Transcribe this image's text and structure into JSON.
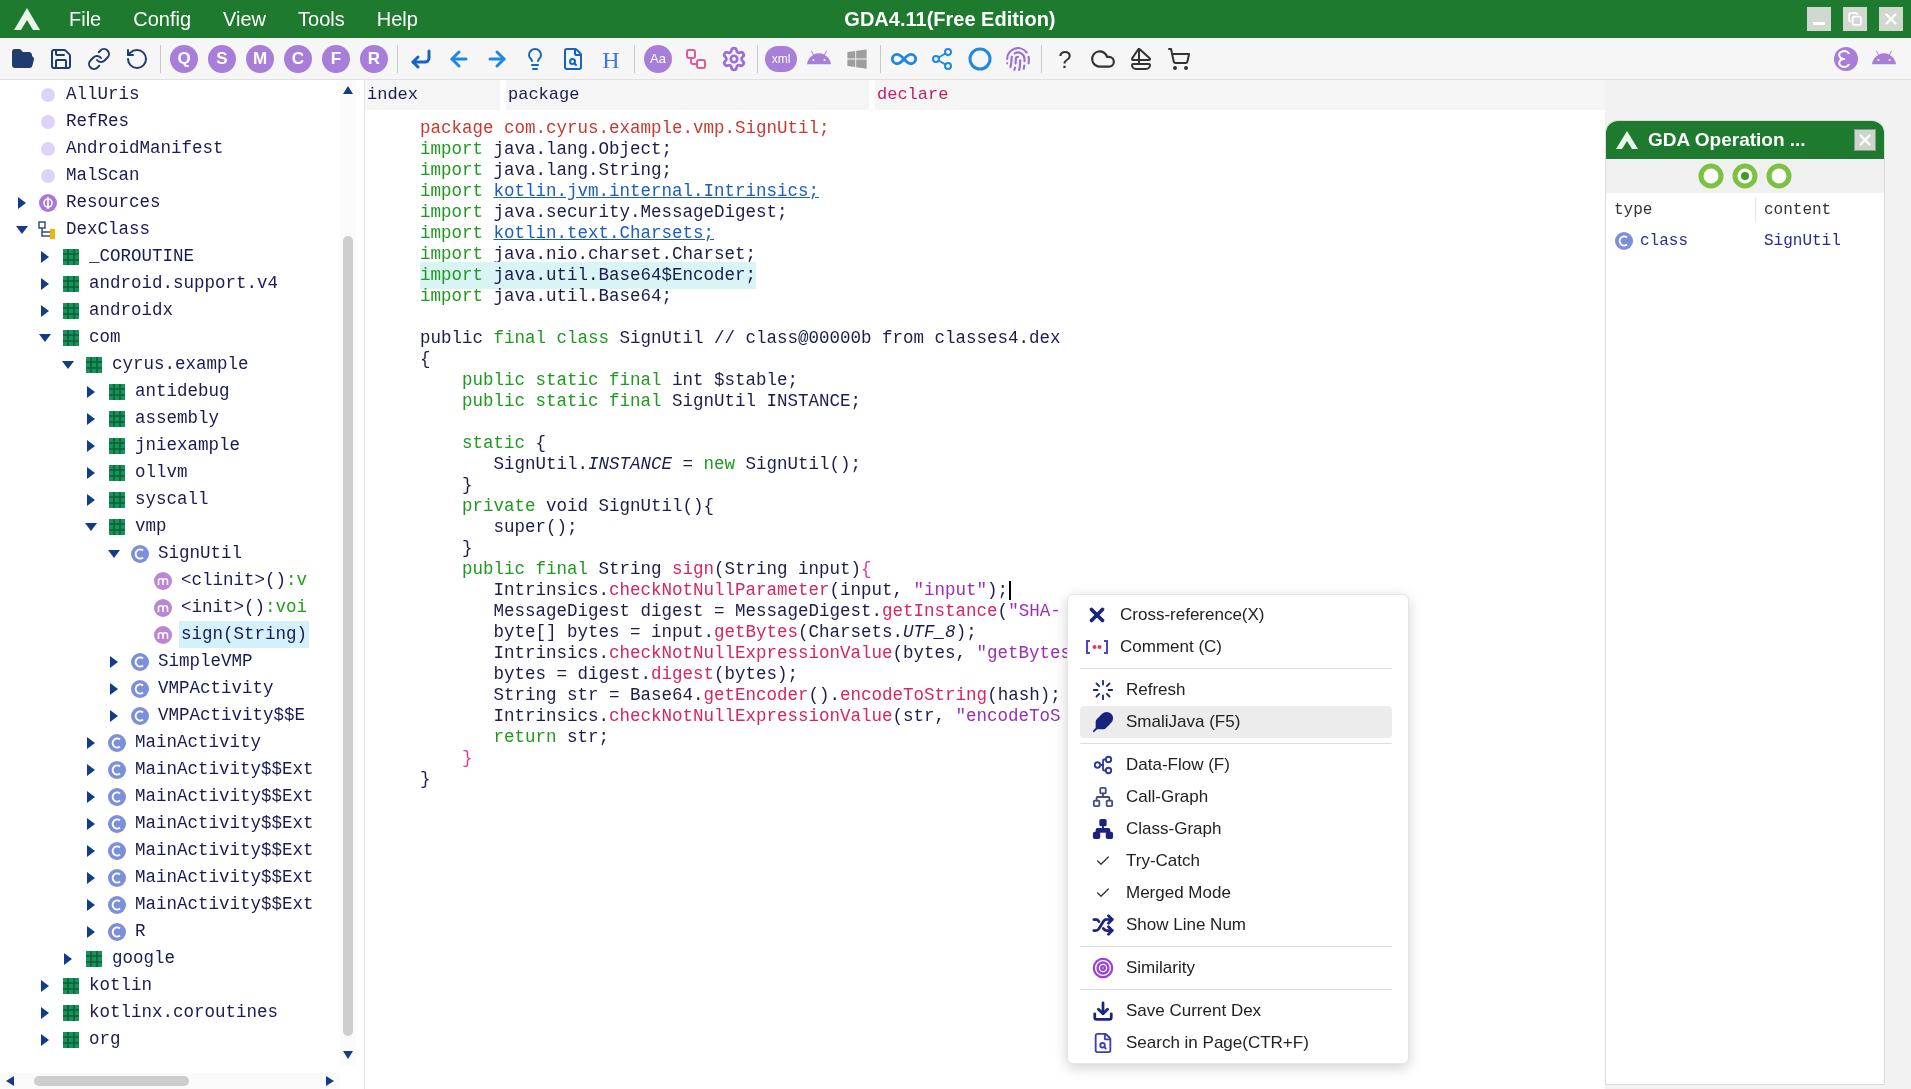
{
  "window": {
    "title": "GDA4.11(Free Edition)"
  },
  "menu_bar": [
    "File",
    "Config",
    "View",
    "Tools",
    "Help"
  ],
  "toolbar": {
    "letter_buttons": [
      "Q",
      "S",
      "M",
      "C",
      "F",
      "R"
    ],
    "heading_button": "H",
    "font_button": "Aa",
    "xml_button": "xml",
    "help_button": "?"
  },
  "tree": [
    {
      "label": "AllUris",
      "kind": "dot",
      "selected": false
    },
    {
      "label": "RefRes",
      "kind": "dot",
      "selected": false
    },
    {
      "label": "AndroidManifest",
      "kind": "dot",
      "selected": false
    },
    {
      "label": "MalScan",
      "kind": "dot",
      "selected": false
    },
    {
      "label": "Resources",
      "kind": "resource",
      "expanded": false,
      "selected": false
    },
    {
      "label": "DexClass",
      "kind": "dexclass",
      "expanded": true,
      "selected": false,
      "children": [
        {
          "label": "_COROUTINE",
          "kind": "package",
          "expanded": false,
          "selected": false
        },
        {
          "label": "android.support.v4",
          "kind": "package",
          "expanded": false,
          "selected": false
        },
        {
          "label": "androidx",
          "kind": "package",
          "expanded": false,
          "selected": false
        },
        {
          "label": "com",
          "kind": "package",
          "expanded": true,
          "selected": false,
          "children": [
            {
              "label": "cyrus.example",
              "kind": "package",
              "expanded": true,
              "selected": false,
              "children": [
                {
                  "label": "antidebug",
                  "kind": "package",
                  "expanded": false,
                  "selected": false
                },
                {
                  "label": "assembly",
                  "kind": "package",
                  "expanded": false,
                  "selected": false
                },
                {
                  "label": "jniexample",
                  "kind": "package",
                  "expanded": false,
                  "selected": false
                },
                {
                  "label": "ollvm",
                  "kind": "package",
                  "expanded": false,
                  "selected": false
                },
                {
                  "label": "syscall",
                  "kind": "package",
                  "expanded": false,
                  "selected": false
                },
                {
                  "label": "vmp",
                  "kind": "package",
                  "expanded": true,
                  "selected": false,
                  "children": [
                    {
                      "label": "SignUtil",
                      "kind": "class",
                      "expanded": true,
                      "selected": false,
                      "children": [
                        {
                          "label": "<clinit>()",
                          "return_type": ":v",
                          "kind": "method",
                          "selected": false
                        },
                        {
                          "label": "<init>()",
                          "return_type": ":voi",
                          "kind": "method",
                          "selected": false
                        },
                        {
                          "label": "sign(String)",
                          "kind": "method",
                          "selected": true
                        }
                      ]
                    },
                    {
                      "label": "SimpleVMP",
                      "kind": "class",
                      "expanded": false,
                      "selected": false
                    },
                    {
                      "label": "VMPActivity",
                      "kind": "class",
                      "expanded": false,
                      "selected": false
                    },
                    {
                      "label": "VMPActivity$$E",
                      "kind": "class",
                      "expanded": false,
                      "selected": false
                    }
                  ]
                },
                {
                  "label": "MainActivity",
                  "kind": "class",
                  "expanded": false,
                  "selected": false
                },
                {
                  "label": "MainActivity$$Ext",
                  "kind": "class",
                  "expanded": false,
                  "selected": false
                },
                {
                  "label": "MainActivity$$Ext",
                  "kind": "class",
                  "expanded": false,
                  "selected": false
                },
                {
                  "label": "MainActivity$$Ext",
                  "kind": "class",
                  "expanded": false,
                  "selected": false
                },
                {
                  "label": "MainActivity$$Ext",
                  "kind": "class",
                  "expanded": false,
                  "selected": false
                },
                {
                  "label": "MainActivity$$Ext",
                  "kind": "class",
                  "expanded": false,
                  "selected": false
                },
                {
                  "label": "MainActivity$$Ext",
                  "kind": "class",
                  "expanded": false,
                  "selected": false
                },
                {
                  "label": "R",
                  "kind": "class",
                  "expanded": false,
                  "selected": false
                }
              ]
            },
            {
              "label": "google",
              "kind": "package",
              "expanded": false,
              "selected": false
            }
          ]
        },
        {
          "label": "kotlin",
          "kind": "package",
          "expanded": false,
          "selected": false
        },
        {
          "label": "kotlinx.coroutines",
          "kind": "package",
          "expanded": false,
          "selected": false
        },
        {
          "label": "org",
          "kind": "package",
          "expanded": false,
          "selected": false
        }
      ]
    }
  ],
  "columns": [
    "index",
    "package",
    "declare"
  ],
  "code": [
    {
      "kind": "code",
      "highlighted": false,
      "cursor": false,
      "tokens": [
        {
          "kind": "pkg",
          "text": "package com.cyrus.example.vmp.SignUtil;"
        }
      ]
    },
    {
      "kind": "code",
      "highlighted": false,
      "cursor": false,
      "tokens": [
        {
          "kind": "kw",
          "text": "import"
        },
        {
          "kind": "plain",
          "text": " java.lang.Object;"
        }
      ]
    },
    {
      "kind": "code",
      "highlighted": false,
      "cursor": false,
      "tokens": [
        {
          "kind": "kw",
          "text": "import"
        },
        {
          "kind": "plain",
          "text": " java.lang.String;"
        }
      ]
    },
    {
      "kind": "code",
      "highlighted": false,
      "cursor": false,
      "tokens": [
        {
          "kind": "kw",
          "text": "import "
        },
        {
          "kind": "link",
          "text": "kotlin.jvm.internal.Intrinsics;"
        }
      ]
    },
    {
      "kind": "code",
      "highlighted": false,
      "cursor": false,
      "tokens": [
        {
          "kind": "kw",
          "text": "import"
        },
        {
          "kind": "plain",
          "text": " java.security.MessageDigest;"
        }
      ]
    },
    {
      "kind": "code",
      "highlighted": false,
      "cursor": false,
      "tokens": [
        {
          "kind": "kw",
          "text": "import "
        },
        {
          "kind": "link",
          "text": "kotlin.text.Charsets;"
        }
      ]
    },
    {
      "kind": "code",
      "highlighted": false,
      "cursor": false,
      "tokens": [
        {
          "kind": "kw",
          "text": "import"
        },
        {
          "kind": "plain",
          "text": " java.nio.charset.Charset;"
        }
      ]
    },
    {
      "kind": "code",
      "highlighted": true,
      "cursor": false,
      "tokens": [
        {
          "kind": "kw",
          "text": "import"
        },
        {
          "kind": "plain",
          "text": " java.util.Base64$Encoder;"
        }
      ]
    },
    {
      "kind": "code",
      "highlighted": false,
      "cursor": false,
      "tokens": [
        {
          "kind": "kw",
          "text": "import"
        },
        {
          "kind": "plain",
          "text": " java.util.Base64;"
        }
      ]
    },
    {
      "kind": "blank"
    },
    {
      "kind": "code",
      "highlighted": false,
      "cursor": false,
      "tokens": [
        {
          "kind": "plain",
          "text": "public "
        },
        {
          "kind": "kw",
          "text": "final class"
        },
        {
          "kind": "plain",
          "text": " SignUtil // class@00000b from classes4.dex"
        }
      ]
    },
    {
      "kind": "code",
      "highlighted": false,
      "cursor": false,
      "tokens": [
        {
          "kind": "plain",
          "text": "{"
        }
      ]
    },
    {
      "kind": "code",
      "highlighted": false,
      "cursor": false,
      "tokens": [
        {
          "kind": "kw",
          "text": "    public static final"
        },
        {
          "kind": "plain",
          "text": " int $stable;"
        }
      ]
    },
    {
      "kind": "code",
      "highlighted": false,
      "cursor": false,
      "tokens": [
        {
          "kind": "kw",
          "text": "    public static final"
        },
        {
          "kind": "plain",
          "text": " SignUtil INSTANCE;"
        }
      ]
    },
    {
      "kind": "blank"
    },
    {
      "kind": "code",
      "highlighted": false,
      "cursor": false,
      "tokens": [
        {
          "kind": "kw",
          "text": "    static"
        },
        {
          "kind": "plain",
          "text": " {"
        }
      ]
    },
    {
      "kind": "code",
      "highlighted": false,
      "cursor": false,
      "tokens": [
        {
          "kind": "plain",
          "text": "       SignUtil."
        },
        {
          "kind": "italic",
          "text": "INSTANCE"
        },
        {
          "kind": "plain",
          "text": " = "
        },
        {
          "kind": "kw",
          "text": "new"
        },
        {
          "kind": "plain",
          "text": " SignUtil();"
        }
      ]
    },
    {
      "kind": "code",
      "highlighted": false,
      "cursor": false,
      "tokens": [
        {
          "kind": "plain",
          "text": "    }"
        }
      ]
    },
    {
      "kind": "code",
      "highlighted": false,
      "cursor": false,
      "tokens": [
        {
          "kind": "kw",
          "text": "    private"
        },
        {
          "kind": "plain",
          "text": " void SignUtil(){"
        }
      ]
    },
    {
      "kind": "code",
      "highlighted": false,
      "cursor": false,
      "tokens": [
        {
          "kind": "plain",
          "text": "       super();"
        }
      ]
    },
    {
      "kind": "code",
      "highlighted": false,
      "cursor": false,
      "tokens": [
        {
          "kind": "plain",
          "text": "    }"
        }
      ]
    },
    {
      "kind": "code",
      "highlighted": false,
      "cursor": false,
      "tokens": [
        {
          "kind": "kw",
          "text": "    public final"
        },
        {
          "kind": "plain",
          "text": " String "
        },
        {
          "kind": "call",
          "text": "sign"
        },
        {
          "kind": "plain",
          "text": "(String input)"
        },
        {
          "kind": "brace",
          "text": "{"
        }
      ]
    },
    {
      "kind": "code",
      "highlighted": false,
      "cursor": true,
      "tokens": [
        {
          "kind": "plain",
          "text": "       Intrinsics."
        },
        {
          "kind": "call",
          "text": "checkNotNullParameter"
        },
        {
          "kind": "plain",
          "text": "(input, "
        },
        {
          "kind": "str",
          "text": "\"input\""
        },
        {
          "kind": "plain",
          "text": ");"
        }
      ]
    },
    {
      "kind": "code",
      "highlighted": false,
      "cursor": false,
      "tokens": [
        {
          "kind": "plain",
          "text": "       MessageDigest digest = MessageDigest."
        },
        {
          "kind": "call",
          "text": "getInstance"
        },
        {
          "kind": "plain",
          "text": "("
        },
        {
          "kind": "str",
          "text": "\"SHA-"
        }
      ]
    },
    {
      "kind": "code",
      "highlighted": false,
      "cursor": false,
      "tokens": [
        {
          "kind": "plain",
          "text": "       byte[] bytes = input."
        },
        {
          "kind": "call",
          "text": "getBytes"
        },
        {
          "kind": "plain",
          "text": "(Charsets."
        },
        {
          "kind": "italic",
          "text": "UTF_8"
        },
        {
          "kind": "plain",
          "text": ");"
        }
      ]
    },
    {
      "kind": "code",
      "highlighted": false,
      "cursor": false,
      "tokens": [
        {
          "kind": "plain",
          "text": "       Intrinsics."
        },
        {
          "kind": "call",
          "text": "checkNotNullExpressionValue"
        },
        {
          "kind": "plain",
          "text": "(bytes, "
        },
        {
          "kind": "str",
          "text": "\"getBytes"
        }
      ]
    },
    {
      "kind": "code",
      "highlighted": false,
      "cursor": false,
      "tokens": [
        {
          "kind": "plain",
          "text": "       bytes = digest."
        },
        {
          "kind": "call",
          "text": "digest"
        },
        {
          "kind": "plain",
          "text": "(bytes);"
        }
      ]
    },
    {
      "kind": "code",
      "highlighted": false,
      "cursor": false,
      "tokens": [
        {
          "kind": "plain",
          "text": "       String str = Base64."
        },
        {
          "kind": "call",
          "text": "getEncoder"
        },
        {
          "kind": "plain",
          "text": "()."
        },
        {
          "kind": "call",
          "text": "encodeToString"
        },
        {
          "kind": "plain",
          "text": "(hash);"
        }
      ]
    },
    {
      "kind": "code",
      "highlighted": false,
      "cursor": false,
      "tokens": [
        {
          "kind": "plain",
          "text": "       Intrinsics."
        },
        {
          "kind": "call",
          "text": "checkNotNullExpressionValue"
        },
        {
          "kind": "plain",
          "text": "(str, "
        },
        {
          "kind": "str",
          "text": "\"encodeToS"
        }
      ]
    },
    {
      "kind": "code",
      "highlighted": false,
      "cursor": false,
      "tokens": [
        {
          "kind": "kw",
          "text": "       return"
        },
        {
          "kind": "plain",
          "text": " str;"
        }
      ]
    },
    {
      "kind": "code",
      "highlighted": false,
      "cursor": false,
      "tokens": [
        {
          "kind": "brace",
          "text": "    }"
        }
      ]
    },
    {
      "kind": "code",
      "highlighted": false,
      "cursor": false,
      "tokens": [
        {
          "kind": "plain",
          "text": "}"
        }
      ]
    }
  ],
  "context_menu": {
    "groups": [
      {
        "items": [
          {
            "label": "Cross-reference(X)",
            "kind": "crossref",
            "highlighted": false
          },
          {
            "label": "Comment (C)",
            "kind": "comment",
            "highlighted": false
          }
        ]
      },
      {
        "items": [
          {
            "label": "Refresh",
            "kind": "refresh",
            "highlighted": false
          },
          {
            "label": "SmaliJava (F5)",
            "kind": "smali",
            "highlighted": true
          }
        ]
      },
      {
        "items": [
          {
            "label": "Data-Flow (F)",
            "kind": "dataflow",
            "highlighted": false
          },
          {
            "label": "Call-Graph",
            "kind": "callgraph",
            "highlighted": false
          },
          {
            "label": "Class-Graph",
            "kind": "classgraph",
            "highlighted": false
          },
          {
            "label": "Try-Catch",
            "kind": "check",
            "checked": true,
            "highlighted": false
          },
          {
            "label": "Merged Mode",
            "kind": "check",
            "checked": true,
            "highlighted": false
          },
          {
            "label": "Show Line Num",
            "kind": "shuffle",
            "highlighted": false
          }
        ]
      },
      {
        "items": [
          {
            "label": "Similarity",
            "kind": "similarity",
            "highlighted": false
          }
        ]
      },
      {
        "items": [
          {
            "label": "Save Current Dex",
            "kind": "download",
            "highlighted": false
          },
          {
            "label": "Search in Page(CTR+F)",
            "kind": "search",
            "highlighted": false
          }
        ]
      }
    ]
  },
  "operation_panel": {
    "title": "GDA Operation ...",
    "pager": [
      {
        "selected": false
      },
      {
        "selected": true
      },
      {
        "selected": false
      }
    ],
    "columns": [
      "type",
      "content"
    ],
    "rows": [
      {
        "type": "class",
        "content": "SignUtil"
      }
    ]
  }
}
